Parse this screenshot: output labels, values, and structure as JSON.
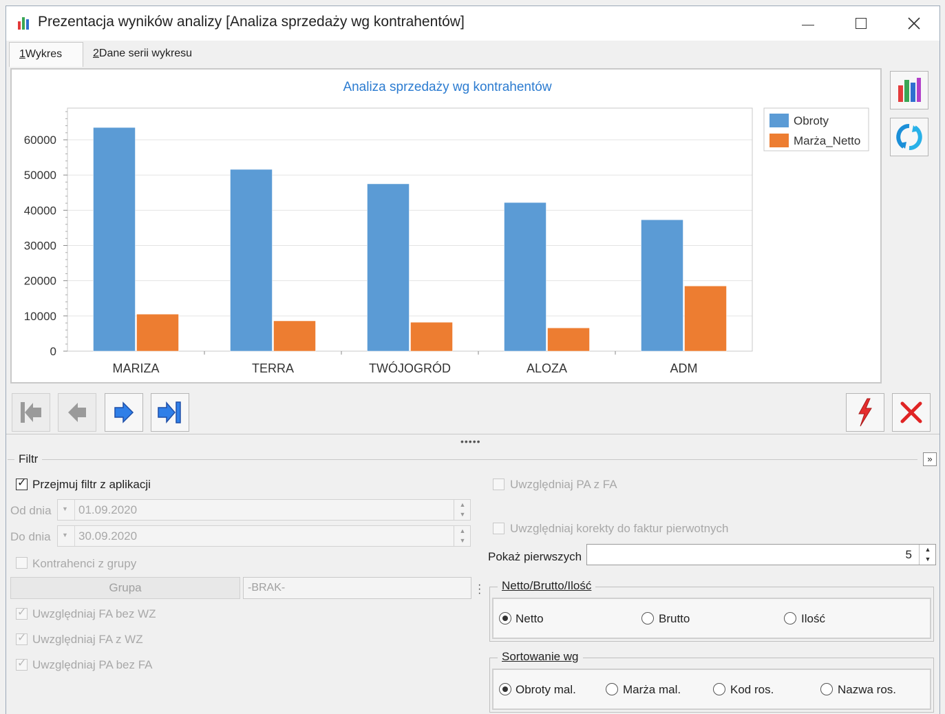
{
  "window": {
    "title": "Prezentacja wyników analizy [Analiza sprzedaży wg kontrahentów]"
  },
  "tabs": [
    {
      "key": "1",
      "label": "Wykres",
      "active": true
    },
    {
      "key": "2",
      "label": "Dane serii wykresu",
      "active": false
    }
  ],
  "chart_data": {
    "type": "bar",
    "title": "Analiza sprzedaży wg kontrahentów",
    "categories": [
      "MARIZA",
      "TERRA",
      "TWÓJOGRÓD",
      "ALOZA",
      "ADM"
    ],
    "series": [
      {
        "name": "Obroty",
        "color": "#5b9bd5",
        "values": [
          63500,
          51600,
          47500,
          42200,
          37300
        ]
      },
      {
        "name": "Marża_Netto",
        "color": "#ed7d31",
        "values": [
          10500,
          8600,
          8200,
          6600,
          18500
        ]
      }
    ],
    "ylim": [
      0,
      69000
    ],
    "yticks": [
      0,
      10000,
      20000,
      30000,
      40000,
      50000,
      60000
    ],
    "ytick_labels": [
      "0",
      "10000",
      "20000",
      "30000",
      "40000",
      "50000",
      "60000"
    ],
    "grid": true,
    "legend": "top-right"
  },
  "icons": {
    "chart_type": "bar-chart-icon",
    "refresh": "refresh-icon",
    "first": "first-record-icon",
    "prev": "previous-record-icon",
    "next": "next-record-icon",
    "last": "last-record-icon",
    "lightning": "lightning-icon",
    "close": "close-icon"
  },
  "filter": {
    "title": "Filtr",
    "przejmuj": {
      "label": "Przejmuj filtr z aplikacji",
      "checked": true
    },
    "od_dnia": {
      "label": "Od dnia",
      "value": "01.09.2020"
    },
    "do_dnia": {
      "label": "Do dnia",
      "value": "30.09.2020"
    },
    "kontrahenci": {
      "label": "Kontrahenci z grupy",
      "checked": false
    },
    "grupa": {
      "button": "Grupa",
      "value": "-BRAK-"
    },
    "fa_bez_wz": {
      "label": "Uwzględniaj FA bez WZ",
      "checked": true
    },
    "fa_z_wz": {
      "label": "Uwzględniaj FA z WZ",
      "checked": true
    },
    "pa_bez_fa": {
      "label": "Uwzględniaj PA bez FA",
      "checked": true
    },
    "pa_z_fa": {
      "label": "Uwzględniaj PA z FA",
      "checked": false
    },
    "korekty": {
      "label": "Uwzględniaj korekty do faktur pierwotnych",
      "checked": false
    },
    "pokaz": {
      "label": "Pokaż pierwszych",
      "value": "5"
    },
    "netto_group": {
      "title": "Netto/Brutto/Ilość",
      "options": [
        "Netto",
        "Brutto",
        "Ilość"
      ],
      "selected": "Netto"
    },
    "sort_group": {
      "title": "Sortowanie wg",
      "options": [
        "Obroty mal.",
        "Marża mal.",
        "Kod ros.",
        "Nazwa ros."
      ],
      "selected": "Obroty mal."
    }
  }
}
